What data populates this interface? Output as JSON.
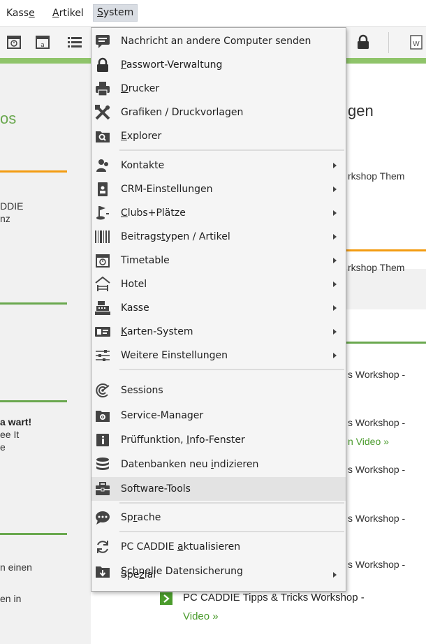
{
  "menubar": {
    "items": [
      {
        "pre": "Kass",
        "acc": "e",
        "post": ""
      },
      {
        "pre": "",
        "acc": "A",
        "post": "rtikel"
      },
      {
        "pre": "",
        "acc": "S",
        "post": "ystem"
      }
    ]
  },
  "menu": {
    "items": [
      {
        "pre": "Nachricht an andere Computer senden",
        "acc": "",
        "post": "",
        "submenu": false,
        "icon": "chat-icon"
      },
      {
        "pre": "",
        "acc": "P",
        "post": "asswort-Verwaltung",
        "submenu": false,
        "icon": "lock-icon"
      },
      {
        "pre": "",
        "acc": "D",
        "post": "rucker",
        "submenu": false,
        "icon": "printer-icon"
      },
      {
        "pre": "Grafiken / Druckvorlagen",
        "acc": "",
        "post": "",
        "submenu": false,
        "icon": "crossed-tools-icon"
      },
      {
        "pre": "",
        "acc": "E",
        "post": "xplorer",
        "submenu": false,
        "icon": "folder-search-icon"
      },
      {
        "pre": "Kontakte",
        "acc": "",
        "post": "",
        "submenu": true,
        "icon": "contacts-icon"
      },
      {
        "pre": "CRM-Einstellungen",
        "acc": "",
        "post": "",
        "submenu": true,
        "icon": "id-badge-icon"
      },
      {
        "pre": "",
        "acc": "C",
        "post": "lubs+Plätze",
        "submenu": true,
        "icon": "golf-flag-icon"
      },
      {
        "pre": "Beitrags",
        "acc": "t",
        "post": "ypen / Artikel",
        "submenu": true,
        "icon": "barcode-icon"
      },
      {
        "pre": "Timetable",
        "acc": "",
        "post": "",
        "submenu": true,
        "icon": "timetable-icon"
      },
      {
        "pre": "Hotel",
        "acc": "",
        "post": "",
        "submenu": true,
        "icon": "hotel-icon"
      },
      {
        "pre": "Kasse",
        "acc": "",
        "post": "",
        "submenu": true,
        "icon": "cash-register-icon"
      },
      {
        "pre": "",
        "acc": "K",
        "post": "arten-System",
        "submenu": true,
        "icon": "card-system-icon"
      },
      {
        "pre": "Weitere Einstellungen",
        "acc": "",
        "post": "",
        "submenu": true,
        "icon": "sliders-icon"
      },
      {
        "pre": "Sessions",
        "acc": "",
        "post": "",
        "submenu": false,
        "icon": "sessions-icon"
      },
      {
        "pre": "Service-Manager",
        "acc": "",
        "post": "",
        "submenu": false,
        "icon": "service-folder-icon"
      },
      {
        "pre": "Prüffunktion, ",
        "acc": "I",
        "post": "nfo-Fenster",
        "submenu": false,
        "icon": "info-icon"
      },
      {
        "pre": "Datenbanken neu ",
        "acc": "i",
        "post": "ndizieren",
        "submenu": false,
        "icon": "database-icon"
      },
      {
        "pre": "Software-Tools",
        "acc": "",
        "post": "",
        "submenu": false,
        "icon": "toolbox-icon"
      },
      {
        "pre": "Sp",
        "acc": "r",
        "post": "ache",
        "submenu": false,
        "icon": "speech-bubble-icon"
      },
      {
        "pre": "PC CADDIE ",
        "acc": "a",
        "post": "ktualisieren",
        "submenu": false,
        "icon": "refresh-icon"
      },
      {
        "pre": "",
        "acc": "S",
        "post": "chnelle Datensicherung",
        "submenu": false,
        "icon": "download-folder-icon"
      },
      {
        "pre": "Spe",
        "acc": "z",
        "post": "ial",
        "submenu": true,
        "icon": ""
      }
    ]
  },
  "background": {
    "left": [
      "os",
      "DDIE",
      "nz",
      "a wart!",
      "ee It",
      "e",
      "n einen",
      "en in"
    ],
    "right": [
      "gen",
      "rkshop Them",
      "rkshop Them",
      "s Workshop -",
      "s Workshop -",
      "n Video »",
      "s Workshop -",
      "s Workshop -",
      "s Workshop -"
    ],
    "bottom_link": "PC CADDIE Tipps & Tricks Workshop -",
    "bottom_link_2": "Video »"
  }
}
